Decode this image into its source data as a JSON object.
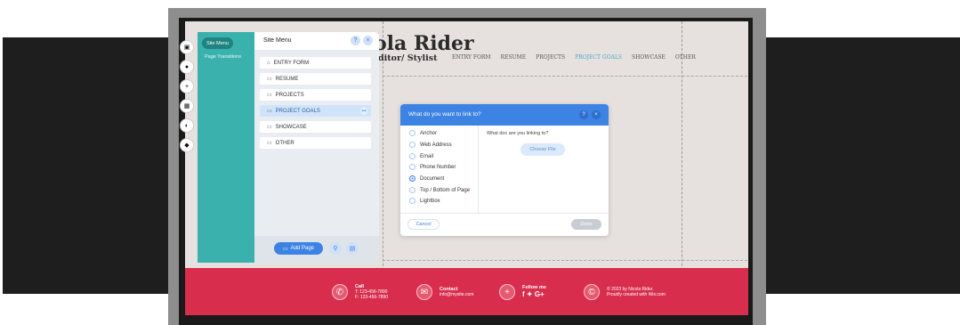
{
  "site": {
    "title": "ola Rider",
    "subtitle": "ditor/ Stylist",
    "nav": [
      "ENTRY FORM",
      "RESUME",
      "PROJECTS",
      "PROJECT GOALS",
      "SHOWCASE",
      "OTHER"
    ],
    "active_nav": "PROJECT GOALS",
    "footer": {
      "call_title": "Call",
      "call_t": "T: 123-456-7890",
      "call_f": "F: 123-456-7890",
      "contact_title": "Contact",
      "contact_email": "info@mysite.com",
      "follow_title": "Follow me",
      "follow_icons": "f ✦ G+",
      "copyright_1": "© 2023 by Nicola Rider.",
      "copyright_2": "Proudly created with Wix.com"
    }
  },
  "editor": {
    "teal_menu": {
      "active_tab": "Site Menu",
      "link": "Page Transitions"
    },
    "panel": {
      "title": "Site Menu",
      "pages": [
        {
          "label": "ENTRY FORM",
          "icon": "home-icon"
        },
        {
          "label": "RESUME",
          "icon": "page-icon"
        },
        {
          "label": "PROJECTS",
          "icon": "page-icon"
        },
        {
          "label": "PROJECT GOALS",
          "icon": "page-icon",
          "selected": true
        },
        {
          "label": "SHOWCASE",
          "icon": "page-icon"
        },
        {
          "label": "OTHER",
          "icon": "page-icon"
        }
      ],
      "add_page": "Add Page"
    }
  },
  "dialog": {
    "title": "What do you want to link to?",
    "options": [
      "Anchor",
      "Web Address",
      "Email",
      "Phone Number",
      "Document",
      "Top / Bottom of Page",
      "Lightbox"
    ],
    "selected": "Document",
    "question": "What doc are you linking to?",
    "choose_file": "Choose File",
    "cancel": "Cancel",
    "done": "Done"
  },
  "colors": {
    "accent_blue": "#3d83e3",
    "teal": "#3bb1ad",
    "footer_red": "#d92d4e"
  }
}
